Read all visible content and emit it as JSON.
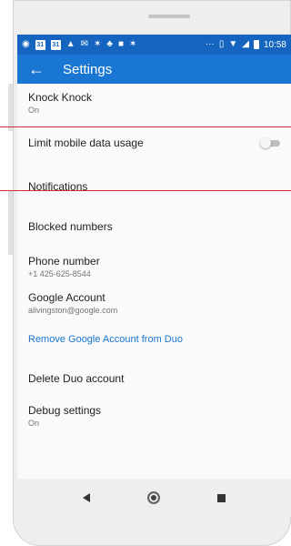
{
  "status_bar": {
    "time": "10:58",
    "left_icons": [
      "location-icon",
      "calendar-icon",
      "calendar-icon",
      "person-icon",
      "chat-icon",
      "game-icon",
      "tree-icon",
      "box-icon",
      "game-icon"
    ],
    "right_icons": [
      "more-icon",
      "vibrate-icon",
      "wifi-icon",
      "signal-icon",
      "battery-icon"
    ],
    "calendar_a": "31",
    "calendar_b": "31",
    "overflow": "···"
  },
  "app_bar": {
    "title": "Settings",
    "back_glyph": "←"
  },
  "settings": {
    "knock_knock": {
      "label": "Knock Knock",
      "value": "On"
    },
    "limit_data": {
      "label": "Limit mobile data usage",
      "enabled": false
    },
    "notifications": {
      "label": "Notifications"
    },
    "blocked_numbers": {
      "label": "Blocked numbers"
    },
    "phone_number": {
      "label": "Phone number",
      "value": "+1 425-625-8544"
    },
    "google_account": {
      "label": "Google Account",
      "value": "alivingston@google.com"
    },
    "remove_account": {
      "label": "Remove Google Account from Duo"
    },
    "delete_account": {
      "label": "Delete Duo account"
    },
    "debug": {
      "label": "Debug settings",
      "value": "On"
    }
  },
  "colors": {
    "status_bar": "#1565c0",
    "app_bar": "#1976d2",
    "link": "#1976d2",
    "guide_line": "#d32f2f"
  }
}
